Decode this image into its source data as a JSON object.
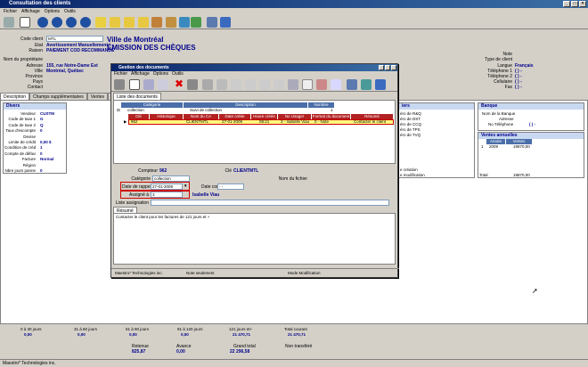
{
  "window": {
    "title": "Consultation des clients"
  },
  "menu": [
    "Fichier",
    "Affichage",
    "Options",
    "Outils"
  ],
  "header": {
    "code_client_label": "Code client",
    "code_client_value": "MTL",
    "etat_label": "Etat",
    "etat_value": "Avertissement Manuellement",
    "raison_label": "Raison",
    "raison_value": "PAIEMENT COD RECOMMANDÉ",
    "client_name": "Ville de Montréal",
    "emission": "ÉMISSION DES CHÈQUES",
    "nom_proprietaire_label": "Nom du propriétaire",
    "adresse_label": "Adresse",
    "adresse_value": "155, rue Notre-Dame Est",
    "ville_label": "Ville",
    "ville_value": "Montréal, Québec",
    "province_label": "Province",
    "pays_label": "Pays",
    "contact_label": "Contact",
    "note_label": "Note",
    "type_client_label": "Type de client",
    "langue_label": "Langue",
    "langue_value": "Français",
    "tel1_label": "Téléphone 1",
    "tel1_value": "(   )   -",
    "tel2_label": "Téléphone 2",
    "tel2_value": "(   )   -",
    "cellulaire_label": "Cellulaire",
    "cellulaire_value": "(   )   -",
    "fax_label": "Fax",
    "fax_value": "(   )   -"
  },
  "tabs": [
    "Description",
    "Champs supplémentaires",
    "Ventes",
    "Ir"
  ],
  "divers": {
    "title": "Divers",
    "rows": [
      {
        "label": "Vendeur",
        "value": "CUSTM"
      },
      {
        "label": "Code de taxe 1",
        "value": "G"
      },
      {
        "label": "Code de taxe 2",
        "value": "Q"
      },
      {
        "label": "Taux d'escompte",
        "value": "0"
      },
      {
        "label": "Devise",
        "value": ""
      },
      {
        "label": "Limite de crédit",
        "value": "0,00 $"
      },
      {
        "label": "Condition de crédit",
        "value": "1"
      },
      {
        "label": "Compte de défaut",
        "value": "0"
      },
      {
        "label": "Facture",
        "value": "Normal"
      },
      {
        "label": "Région",
        "value": ""
      },
      {
        "label": "Nbre jours panne",
        "value": "0"
      }
    ]
  },
  "right_panels": {
    "left_title": "iers",
    "left_rows": [
      "éro de R&Q",
      "éro de DST",
      "éro de CCQ",
      "éro de TPS",
      "éro de TVQ"
    ],
    "creation": "e création",
    "modification": "e modification",
    "banque_title": "Banque",
    "banque_rows": [
      "Nom de la Banque",
      "Adresse",
      "No Téléphone"
    ],
    "banque_tel": "(   )   -",
    "ventes_title": "Ventes annuelles",
    "ventes_headers": [
      "Année",
      "Ventes"
    ],
    "ventes_rows": [
      {
        "num": "1",
        "annee": "2009",
        "ventes": "19870,00"
      }
    ],
    "total_label": "Total",
    "total_value": "19870,00"
  },
  "dialog": {
    "title": "Gestion des documents",
    "menu": [
      "Fichier",
      "Affichage",
      "Options",
      "Outils"
    ],
    "tab": "Liste des documents",
    "top_headers": [
      "Catégorie",
      "Description",
      "Nombre"
    ],
    "category_row": {
      "cat": "collection",
      "desc": "Suivi de collection",
      "count": "1"
    },
    "doc_headers": [
      "Clé",
      "Historique",
      "Nom du CA",
      "Date créée",
      "Heure créée",
      "No Usager",
      "Format du document",
      "Résumé"
    ],
    "doc_row": {
      "cle": "962",
      "historique": "",
      "nom": "CLIENTMTL",
      "date": "27-01-2009",
      "heure": "08:21",
      "usager": "3 - Isabelle Viau",
      "format": "0 - Note",
      "resume": "Contacter le client"
    },
    "compteur_label": "Compteur",
    "compteur_value": "962",
    "cle_label": "Clé",
    "cle_value": "CLIENTMTL",
    "categorie_label": "Catégorie",
    "categorie_value": "collection",
    "nom_fichier_label": "Nom du fichier",
    "date_rappel_label": "Date de rappel",
    "date_rappel_value": "27-01-2009",
    "date_complete_label": "Date complétée",
    "date_complete_value": "- -",
    "assigne_label": "Assigné à",
    "assigne_value": "3",
    "assigne_name": "Isabelle Viau",
    "liste_label": "Liste assignation",
    "resume_tab": "Résumé",
    "resume_text": "Contacter le client pour les factures de 121 jours et +",
    "status": [
      "Maestro* Technologies inc.",
      "Note seulement",
      "Mode Modification"
    ]
  },
  "footer": {
    "buckets": [
      {
        "label": "0 à 30 jours",
        "value": "0,00"
      },
      {
        "label": "31 à 60 jours",
        "value": "0,00"
      },
      {
        "label": "61 à 90 jours",
        "value": "0,00"
      },
      {
        "label": "91 à 120 jours",
        "value": "0,00"
      },
      {
        "label": "121 jours et+",
        "value": "21 470,71"
      },
      {
        "label": "Total courant",
        "value": "21 470,71"
      }
    ],
    "retenue_label": "Retenue",
    "retenue_value": "825,87",
    "avance_label": "Avance",
    "avance_value": "0,00",
    "grand_total_label": "Grand total",
    "grand_total_value": "22 296,58",
    "non_transfere": "Non transféré"
  },
  "status": "Maestro* Technologies inc."
}
